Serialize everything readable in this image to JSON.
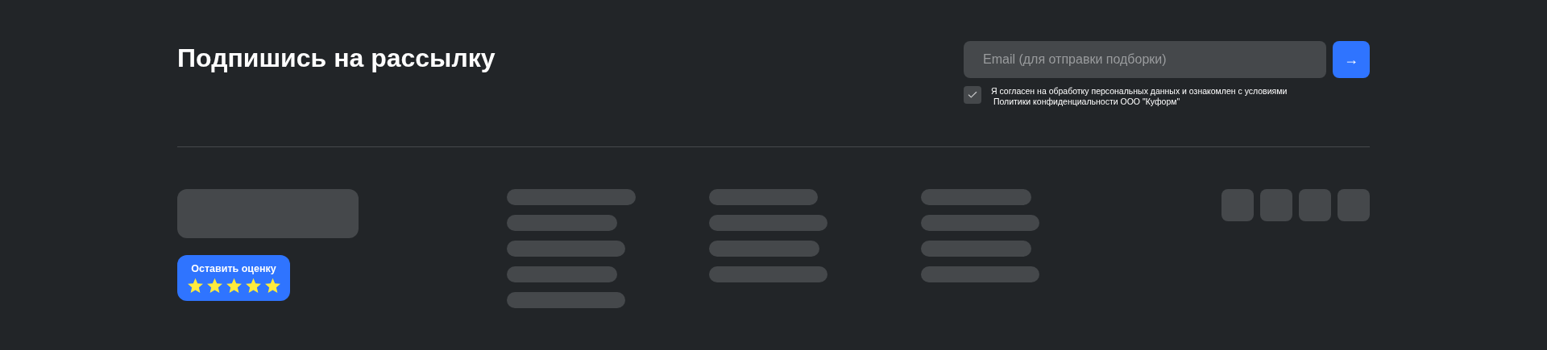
{
  "newsletter": {
    "title": "Подпишись на рассылку",
    "email_field": {
      "placeholder": "Email (для отправки подборки)"
    },
    "submit_button": {
      "label": "→"
    },
    "consent": {
      "checked": true,
      "text": "Я согласен на обработку персональных данных и ознакомлен с условиями\n Политики конфиденциальности ООО \"Куформ\""
    }
  },
  "rating": {
    "label": "Оставить оценку",
    "stars": 5
  }
}
